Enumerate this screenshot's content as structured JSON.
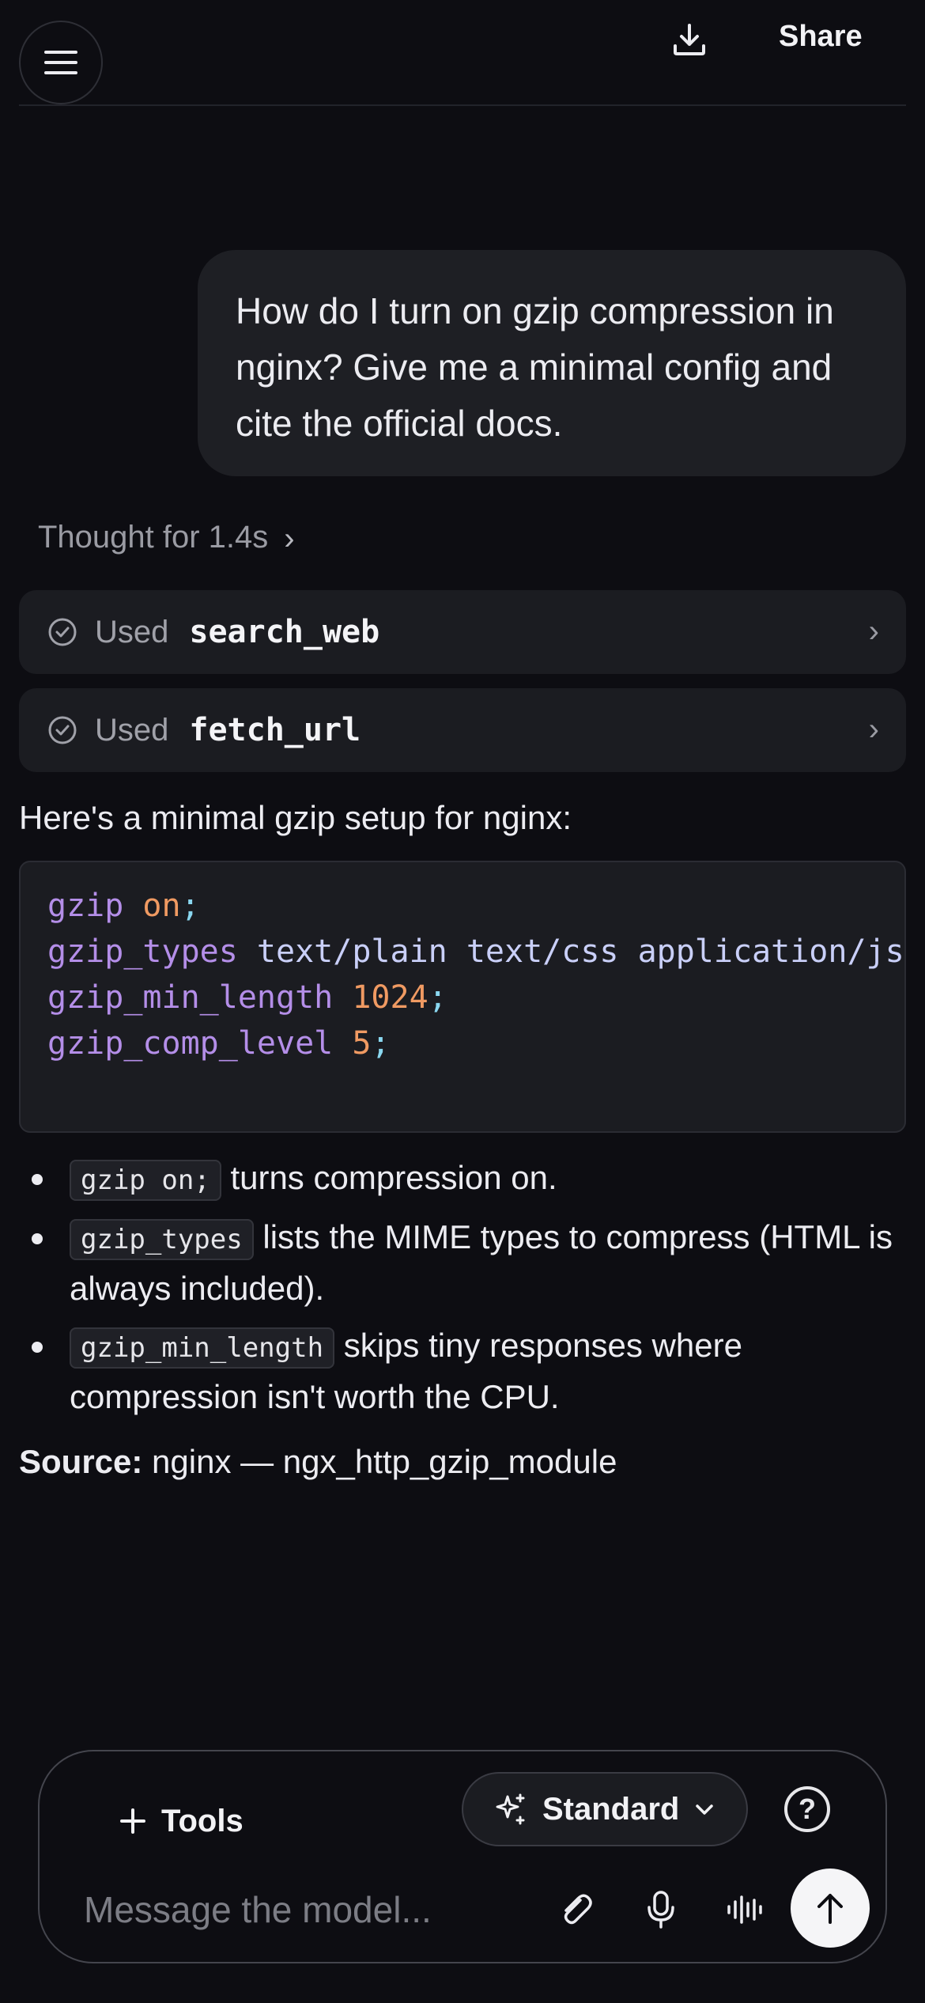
{
  "header": {
    "share_label": "Share",
    "menu_icon": "hamburger-menu-icon",
    "download_icon": "download-icon"
  },
  "conversation": {
    "user_message": "How do I turn on gzip compression in nginx? Give me a minimal config and cite the official docs.",
    "thought_label": "Thought for 1.4s",
    "tools_used": [
      {
        "used_label": "Used",
        "name": "search_web"
      },
      {
        "used_label": "Used",
        "name": "fetch_url"
      }
    ],
    "intro": "Here's a minimal gzip setup for nginx:",
    "code_lines": [
      {
        "directive": "gzip",
        "value": "on",
        "end": ";"
      },
      {
        "directive": "gzip_types",
        "value": "text/plain text/css application/json",
        "end": ""
      },
      {
        "directive": "gzip_min_length",
        "value": "1024",
        "end": ";"
      },
      {
        "directive": "gzip_comp_level",
        "value": "5",
        "end": ";"
      }
    ],
    "bullets": [
      {
        "code": "gzip on;",
        "text": "turns compression on."
      },
      {
        "code": "gzip_types",
        "text": "lists the MIME types to compress (HTML is always included)."
      },
      {
        "code": "gzip_min_length",
        "text": "skips tiny responses where compression isn't worth the CPU."
      }
    ],
    "source_label": "Source:",
    "source_text": "nginx — ngx_http_gzip_module"
  },
  "composer": {
    "tools_label": "Tools",
    "mode_label": "Standard",
    "placeholder": "Message the model...",
    "help_glyph": "?"
  },
  "colors": {
    "background": "#0d0d12",
    "bubble": "#1e1f24",
    "keyword": "#b48ee8",
    "number": "#f09a62",
    "send_button": "#f5f5f7"
  }
}
